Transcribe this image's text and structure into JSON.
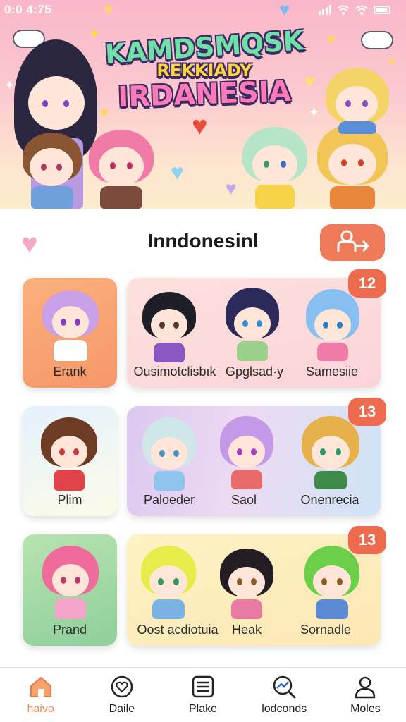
{
  "status_bar": {
    "time": "0:0 4:75"
  },
  "banner": {
    "title_line1": "KAMDSMQSK",
    "title_line2": "REKKIADY",
    "title_line3": "IRDANESIA"
  },
  "header": {
    "title": "Inndonesinl"
  },
  "groups": [
    {
      "featured": {
        "label": "Erank"
      },
      "badge": "12",
      "members": [
        {
          "label": "Ousimotclisbık"
        },
        {
          "label": "Gpglsad·y"
        },
        {
          "label": "Samesiie"
        }
      ]
    },
    {
      "featured": {
        "label": "Plim"
      },
      "badge": "13",
      "members": [
        {
          "label": "Paloeder"
        },
        {
          "label": "Saol"
        },
        {
          "label": "Onenrecia"
        }
      ]
    },
    {
      "featured": {
        "label": "Prand"
      },
      "badge": "13",
      "members": [
        {
          "label": "Oost acdiotuia"
        },
        {
          "label": "Heak"
        },
        {
          "label": "Sornadle"
        }
      ]
    }
  ],
  "nav": [
    {
      "label": "haivo",
      "icon": "home-icon"
    },
    {
      "label": "Daile",
      "icon": "heart-badge-icon"
    },
    {
      "label": "Plake",
      "icon": "list-icon"
    },
    {
      "label": "lodconds",
      "icon": "search-globe-icon"
    },
    {
      "label": "Moles",
      "icon": "profile-icon"
    }
  ],
  "colors": {
    "accent": "#ef6b4f",
    "active_nav": "#f08a5b"
  }
}
